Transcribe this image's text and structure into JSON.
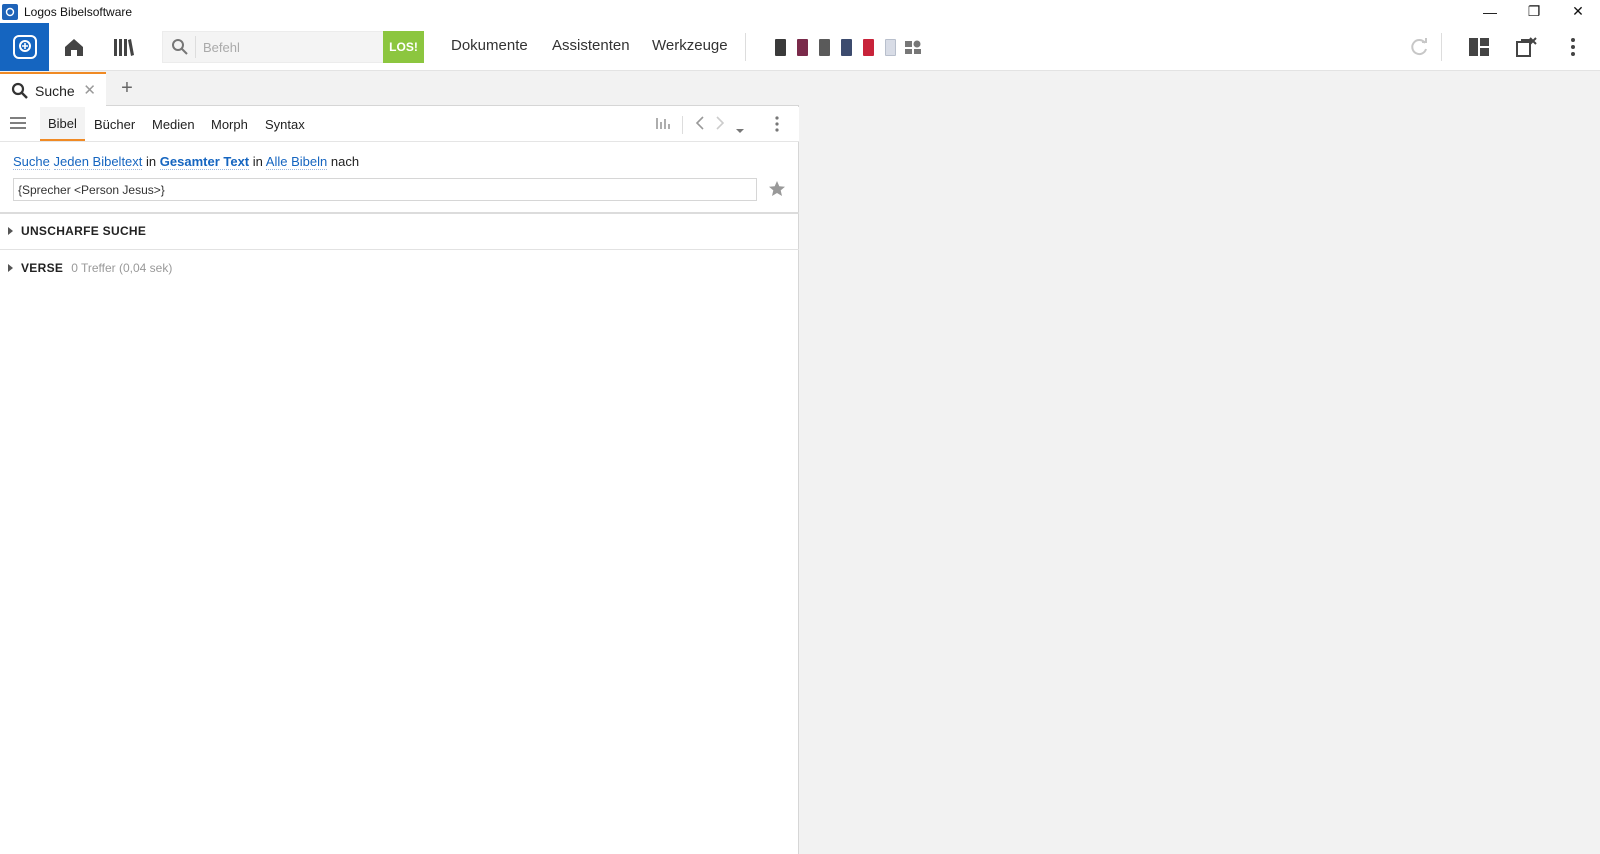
{
  "window": {
    "title": "Logos Bibelsoftware",
    "minimize": "—",
    "restore": "❐",
    "close": "✕"
  },
  "toolbar": {
    "command_placeholder": "Befehl",
    "go_label": "LOS!",
    "menu": [
      "Dokumente",
      "Assistenten",
      "Werkzeuge"
    ],
    "book_colors": [
      "#3a3a3a",
      "#7a2a4a",
      "#5a5a5a",
      "#3c4b6e",
      "#c8233a"
    ]
  },
  "tab": {
    "label": "Suche",
    "close": "✕",
    "add": "+"
  },
  "search": {
    "tabs": [
      "Bibel",
      "Bücher",
      "Medien",
      "Morph",
      "Syntax"
    ],
    "active_tab": "Bibel",
    "query": {
      "w1": "Suche",
      "w2": "Jeden Bibeltext",
      "w3": "in",
      "w4": "Gesamter Text",
      "w5": "in",
      "w6": "Alle Bibeln",
      "w7": "nach"
    },
    "input_value": "{Sprecher <Person Jesus>}",
    "sections": [
      {
        "label": "UNSCHARFE SUCHE",
        "meta": ""
      },
      {
        "label": "VERSE",
        "meta": "0 Treffer (0,04 sek)"
      }
    ]
  },
  "colors": {
    "brand_blue": "#1565c0",
    "accent_orange": "#f08a24",
    "go_green": "#8cc63f"
  }
}
